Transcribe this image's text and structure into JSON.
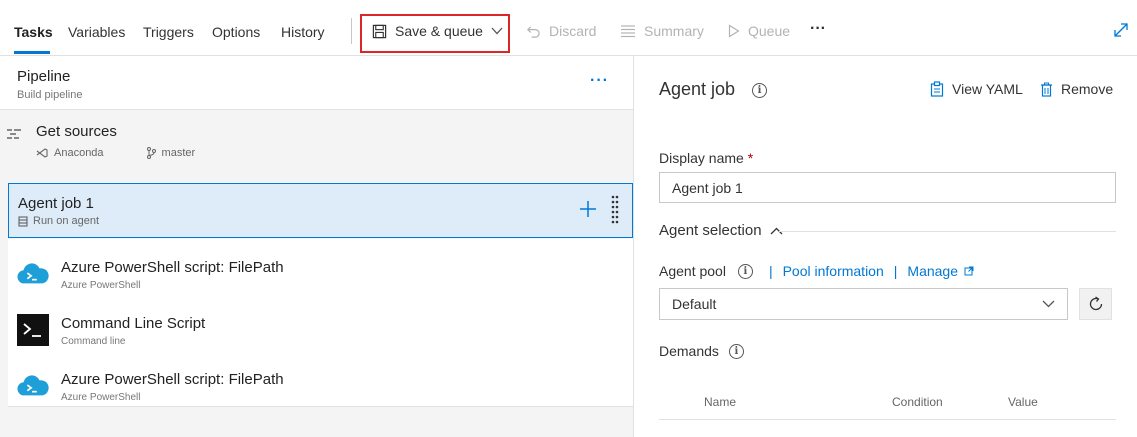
{
  "tabs": [
    {
      "label": "Tasks",
      "active": true
    },
    {
      "label": "Variables"
    },
    {
      "label": "Triggers"
    },
    {
      "label": "Options"
    },
    {
      "label": "History"
    }
  ],
  "toolbar": {
    "save_queue": "Save & queue",
    "discard": "Discard",
    "summary": "Summary",
    "queue": "Queue",
    "more": "···"
  },
  "pipeline": {
    "title": "Pipeline",
    "subtitle": "Build pipeline",
    "more": "···"
  },
  "get_sources": {
    "title": "Get sources",
    "repo": "Anaconda",
    "branch": "master"
  },
  "agent_job_item": {
    "title": "Agent job 1",
    "subtitle": "Run on agent"
  },
  "tasks": [
    {
      "title": "Azure PowerShell script: FilePath",
      "subtitle": "Azure PowerShell",
      "icon": "azure-cloud-icon"
    },
    {
      "title": "Command Line Script",
      "subtitle": "Command line",
      "icon": "terminal-icon"
    },
    {
      "title": "Azure PowerShell script: FilePath",
      "subtitle": "Azure PowerShell",
      "icon": "azure-cloud-icon"
    }
  ],
  "detail": {
    "title": "Agent job",
    "view_yaml": "View YAML",
    "remove": "Remove",
    "display_name_label": "Display name",
    "required_mark": "*",
    "display_name_value": "Agent job 1",
    "agent_selection": "Agent selection",
    "agent_pool_label": "Agent pool",
    "pool_information": "Pool information",
    "manage": "Manage",
    "pool_value": "Default",
    "demands_label": "Demands",
    "columns": [
      "Name",
      "Condition",
      "Value"
    ]
  },
  "colors": {
    "accent": "#0078d4",
    "highlight_border": "#d92626",
    "selected_bg": "#deecf9"
  }
}
